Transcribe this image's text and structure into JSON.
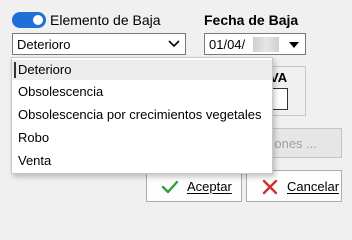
{
  "form": {
    "toggle_label": "Elemento de Baja",
    "toggle_on": true,
    "fecha_label": "Fecha de Baja",
    "motivo_value": "Deterioro",
    "fecha_value": "01/04/",
    "iva_label": "VA",
    "opciones_label": "ones ...",
    "aceptar_label": "Aceptar",
    "cancelar_label": "Cancelar"
  },
  "dropdown": {
    "options": [
      "Deterioro",
      "Obsolescencia",
      "Obsolescencia por crecimientos vegetales",
      "Robo",
      "Venta"
    ],
    "selected_index": 0
  },
  "colors": {
    "accent": "#1f6fd6",
    "check": "#2e9e3e",
    "cancel_x": "#d03030"
  },
  "icons": {
    "aceptar": "check-icon",
    "cancelar": "close-icon",
    "combo": "chevron-down-icon",
    "date": "dropdown-arrow-icon"
  }
}
